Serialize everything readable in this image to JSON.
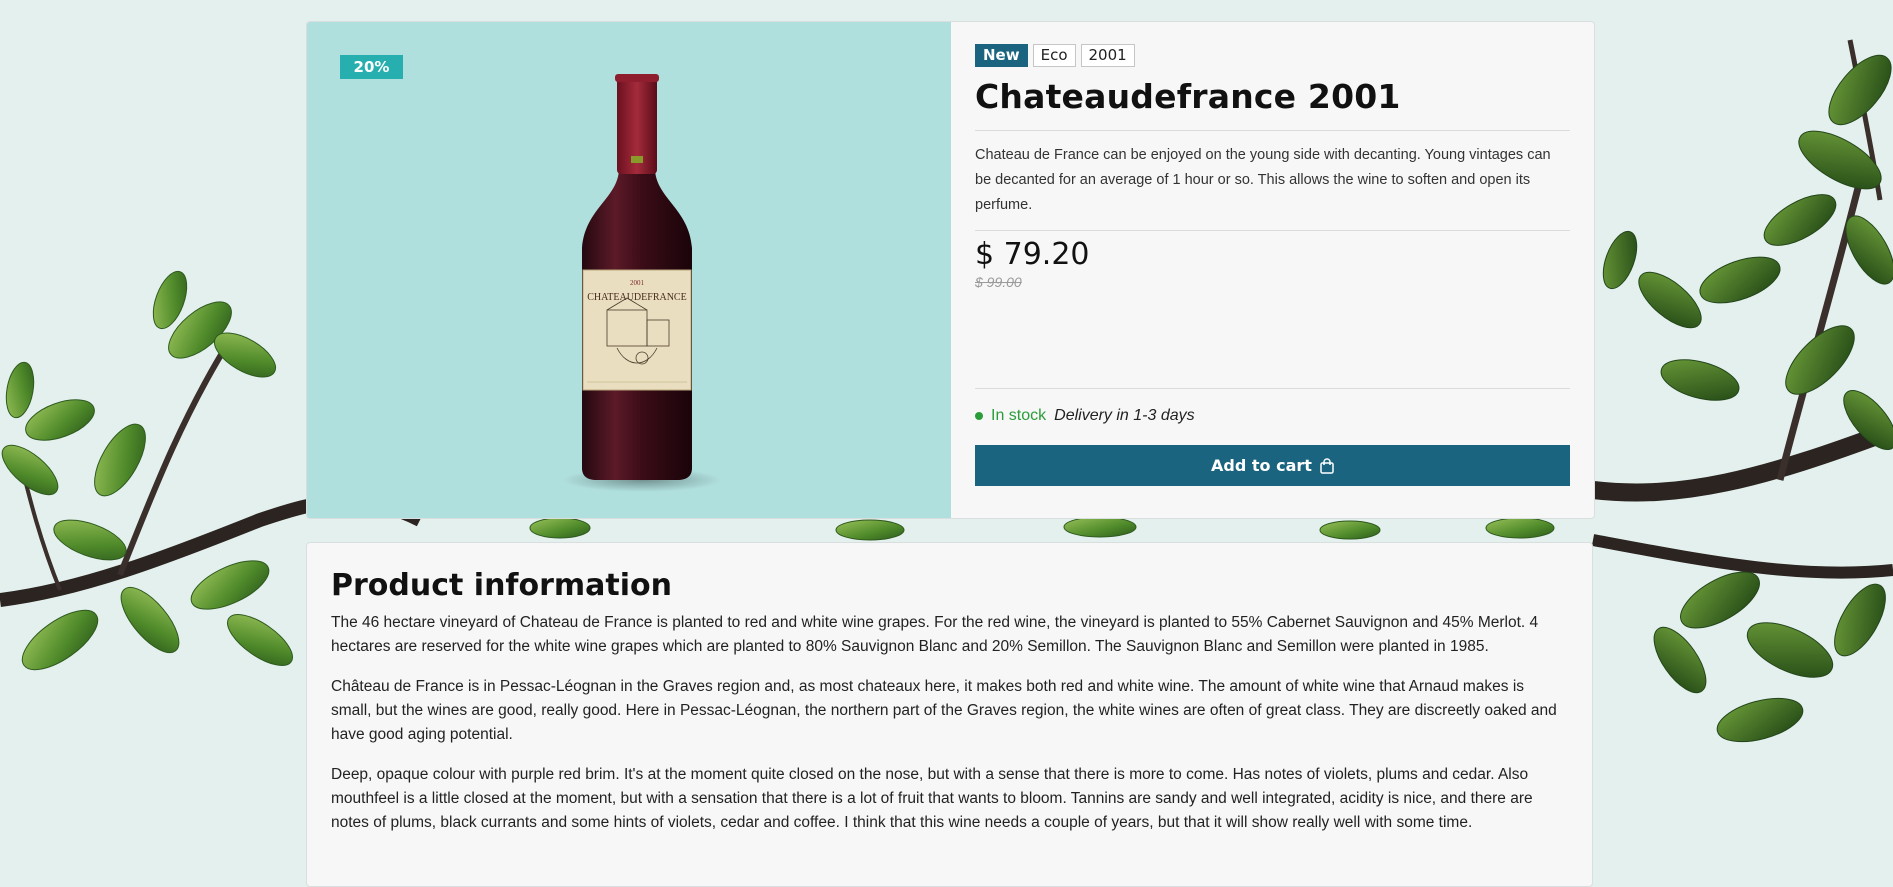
{
  "product": {
    "discount_badge": "20%",
    "tags": [
      "New",
      "Eco",
      "2001"
    ],
    "title": "Chateaudefrance 2001",
    "description": "Chateau de France can be enjoyed on the young side with decanting. Young vintages can be decanted for an average of 1 hour or so. This allows the wine to soften and open its perfume.",
    "price": "$ 79.20",
    "old_price": "$ 99.00",
    "stock_status": "In stock",
    "delivery": "Delivery in 1-3 days",
    "add_to_cart_label": "Add to cart",
    "label_year": "2001",
    "label_name": "CHATEAUDEFRANCE",
    "colors": {
      "accent": "#1b6480",
      "badge": "#27aeae",
      "image_bg": "#b0e0de",
      "in_stock": "#2a9d3a"
    },
    "icons": {
      "cart": "shopping-bag-icon",
      "stock_dot": "status-dot-icon"
    }
  },
  "info": {
    "title": "Product information",
    "paragraphs": [
      "The 46 hectare vineyard of Chateau de France is planted to red and white wine grapes. For the red wine, the vineyard is planted to 55% Cabernet Sauvignon and 45% Merlot. 4 hectares are reserved for the white wine grapes which are planted to 80% Sauvignon Blanc and 20% Semillon. The Sauvignon Blanc and Semillon were planted in 1985.",
      "Château de France is in Pessac-Léognan in the Graves region and, as most chateaux here, it makes both red and white wine. The amount of white wine that Arnaud makes is small, but the wines are good, really good. Here in Pessac-Léognan, the northern part of the Graves region, the white wines are often of great class. They are discreetly oaked and have good aging potential.",
      "Deep, opaque colour with purple red brim. It's at the moment quite closed on the nose, but with a sense that there is more to come. Has notes of violets, plums and cedar. Also mouthfeel is a little closed at the moment, but with a sensation that there is a lot of fruit that wants to bloom. Tannins are sandy and well integrated, acidity is nice, and there are notes of plums, black currants and some hints of violets, cedar and coffee. I think that this wine needs a couple of years, but that it will show really well with some time."
    ]
  }
}
